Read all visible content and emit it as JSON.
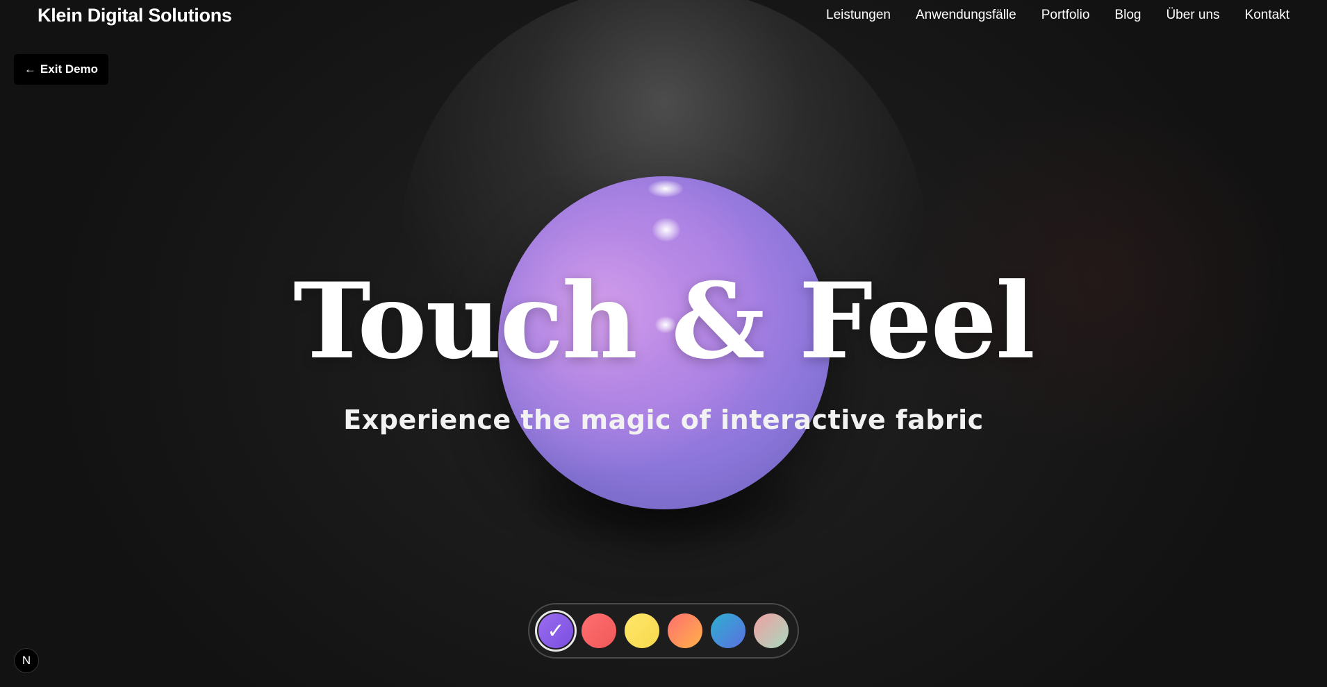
{
  "header": {
    "brand": "Klein Digital Solutions",
    "nav": [
      {
        "label": "Leistungen"
      },
      {
        "label": "Anwendungsfälle"
      },
      {
        "label": "Portfolio"
      },
      {
        "label": "Blog"
      },
      {
        "label": "Über uns"
      },
      {
        "label": "Kontakt"
      }
    ]
  },
  "exit_button": {
    "arrow": "←",
    "label": "Exit Demo"
  },
  "hero": {
    "title": "Touch & Feel",
    "subtitle": "Experience the magic of interactive fabric"
  },
  "sphere": {
    "color": "#a47ee2"
  },
  "swatches": {
    "selected_index": 0,
    "check_glyph": "✓",
    "items": [
      {
        "name": "purple",
        "gradient": "linear-gradient(135deg, #9a6cf0, #7b4fe0)"
      },
      {
        "name": "red",
        "gradient": "linear-gradient(135deg, #ff6f70, #f05858)"
      },
      {
        "name": "yellow",
        "gradient": "linear-gradient(135deg, #ffe76a, #f7d84e)"
      },
      {
        "name": "orange",
        "gradient": "linear-gradient(135deg, #ff6f6f, #ffb14a)"
      },
      {
        "name": "blue",
        "gradient": "linear-gradient(135deg, #2fb0d0, #5a6fe0)"
      },
      {
        "name": "pastel",
        "gradient": "linear-gradient(135deg, #f0a0a0, #a8d8c0)"
      }
    ]
  },
  "badge": {
    "label": "N"
  }
}
